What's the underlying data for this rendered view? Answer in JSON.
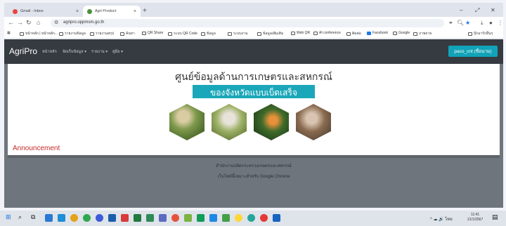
{
  "browser": {
    "tabs": [
      {
        "title": "Gmail - Inbox",
        "active": false
      },
      {
        "title": "Agri Product",
        "active": true
      }
    ],
    "url": "agripro.oppmsm.go.th",
    "bookmarks": [
      "หน้าหลัก | หน้าหลัก...",
      "รายงานข้อมูล",
      "รายงานสรุป",
      "ค้นหา",
      "QR Share",
      "ระบบ QR Code",
      "ข้อมูล",
      "ระบบงาน",
      "ข้อมูลเพิ่มเติม",
      "Web QR",
      "AI conference",
      "ติดต่อ",
      "Facebook",
      "Google",
      "ภาพถ่าย"
    ],
    "bookmarks_other": "บุ๊กมาร์กอื่นๆ"
  },
  "app": {
    "brand": "AgriPro",
    "nav": [
      "หน้าหลัก",
      "จัดเก็บข้อมูล ▾",
      "รายงาน ▾",
      "คู่มือ ▾"
    ],
    "user_button": "paco_cnt (ชื่อนาม)"
  },
  "hero": {
    "title_line1": "ศูนย์ข้อมูลด้านการเกษตรและสหกรณ์",
    "title_line2": "ของจังหวัดแบบเบ็ดเสร็จ",
    "hex_images": [
      "farmer-field",
      "produce-harvest",
      "orchard-fruit",
      "farm-worker"
    ]
  },
  "announcement": {
    "label": "Announcement"
  },
  "footer": {
    "line1": "สำนักงานปลัดกระทรวงเกษตรและสหกรณ์",
    "line2": "เว็บไซต์นี้เหมาะสำหรับ Google Chrome"
  },
  "taskbar": {
    "tray_text": "^ ☁ 🔊 ไทย",
    "time": "11:41",
    "date": "21/1/2567"
  },
  "colors": {
    "navbar": "#363b41",
    "accent": "#12a3b8",
    "announcement": "#c62828",
    "page_bg": "#6f757d"
  }
}
